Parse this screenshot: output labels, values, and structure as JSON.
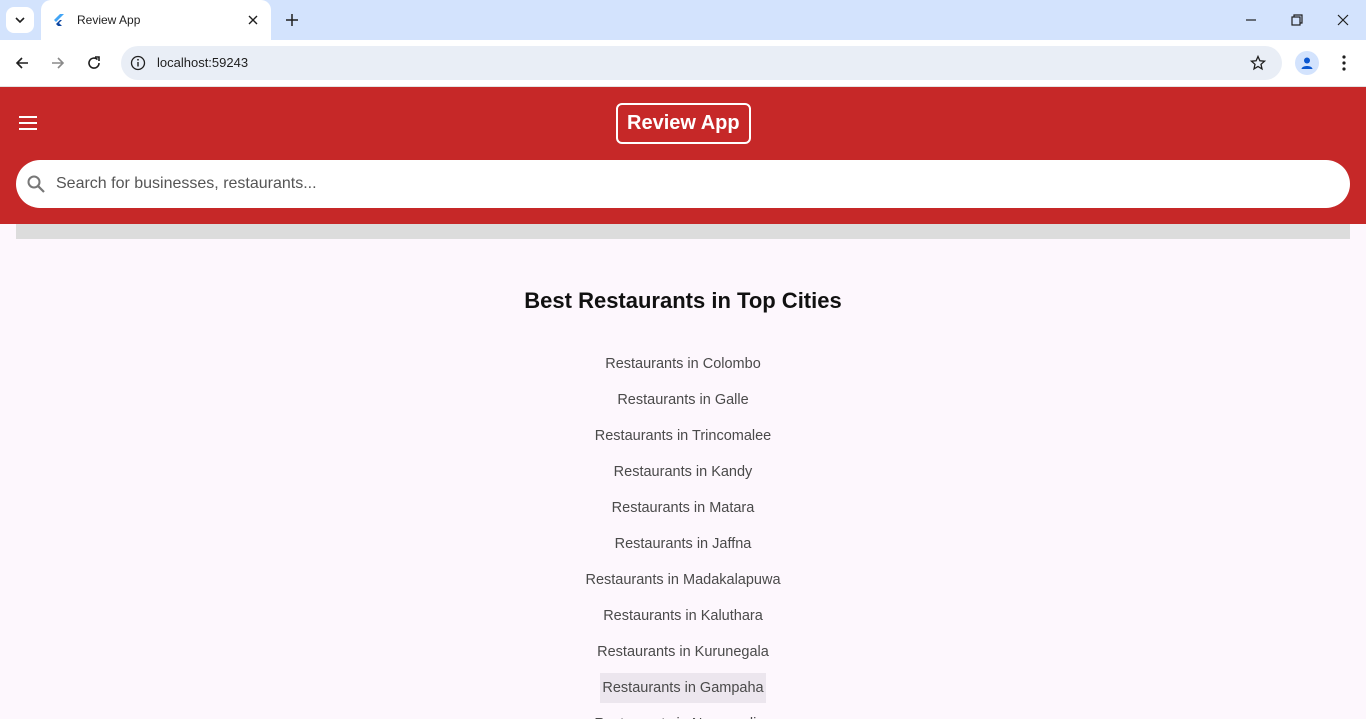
{
  "browser": {
    "tab_title": "Review App",
    "url": "localhost:59243"
  },
  "app": {
    "logo_text": "Review App",
    "search_placeholder": "Search for businesses, restaurants...",
    "section_title": "Best Restaurants in Top Cities",
    "cities": [
      "Restaurants in Colombo",
      "Restaurants in Galle",
      "Restaurants in Trincomalee",
      "Restaurants in Kandy",
      "Restaurants in Matara",
      "Restaurants in Jaffna",
      "Restaurants in Madakalapuwa",
      "Restaurants in Kaluthara",
      "Restaurants in Kurunegala",
      "Restaurants in Gampaha",
      "Restaurants in Nuwaraeliya"
    ],
    "hovered_city": "Restaurants in Gampaha"
  },
  "colors": {
    "brand": "#c62828",
    "page_background": "#fdf7fd",
    "tabstrip": "#d3e3fd"
  },
  "icons": [
    "tab-search-icon",
    "flutter-favicon-icon",
    "close-icon",
    "plus-icon",
    "minimize-icon",
    "restore-icon",
    "window-close-icon",
    "back-icon",
    "forward-icon",
    "reload-icon",
    "info-icon",
    "star-icon",
    "profile-icon",
    "more-vert-icon",
    "menu-icon",
    "search-icon"
  ]
}
